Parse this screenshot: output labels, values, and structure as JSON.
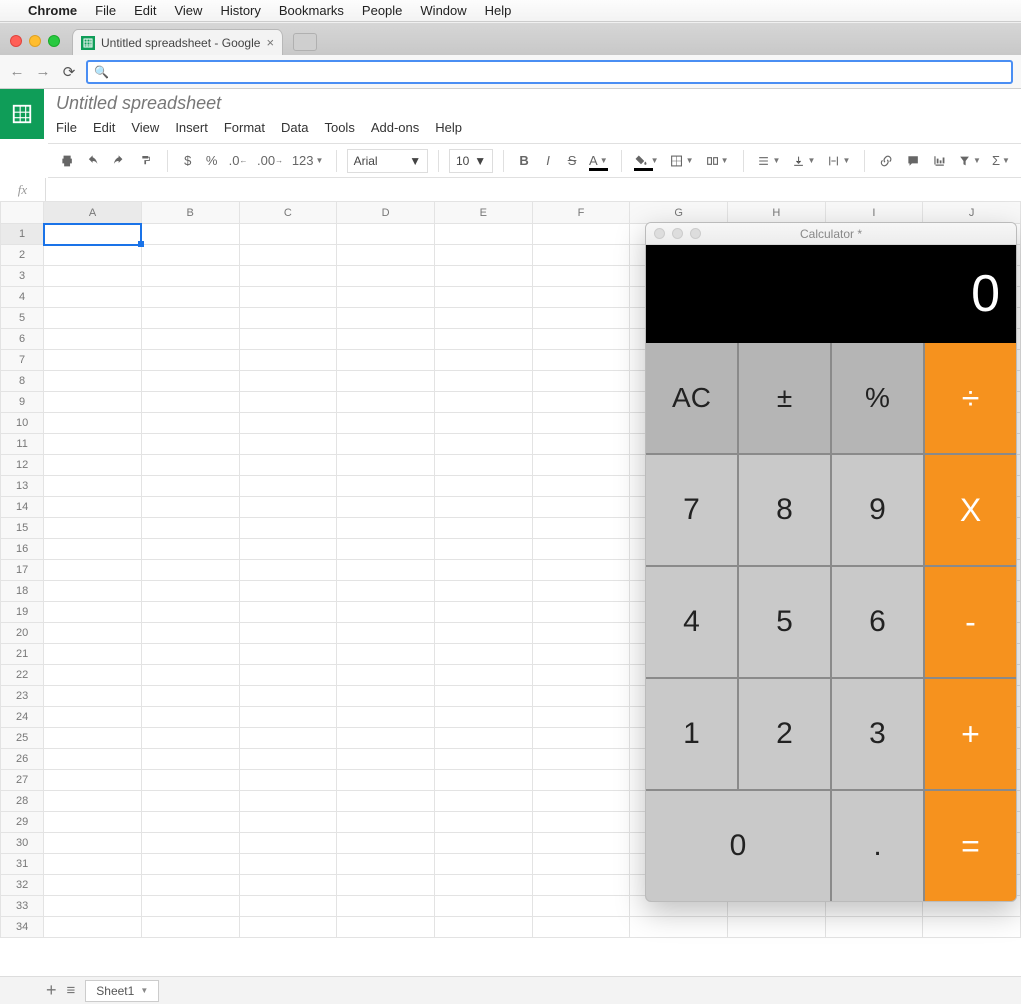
{
  "mac_menubar": {
    "apple": "",
    "app": "Chrome",
    "items": [
      "File",
      "Edit",
      "View",
      "History",
      "Bookmarks",
      "People",
      "Window",
      "Help"
    ]
  },
  "chrome": {
    "tab_title": "Untitled spreadsheet - Google",
    "omnibox_value": ""
  },
  "sheets": {
    "doc_title": "Untitled spreadsheet",
    "menus": [
      "File",
      "Edit",
      "View",
      "Insert",
      "Format",
      "Data",
      "Tools",
      "Add-ons",
      "Help"
    ],
    "toolbar": {
      "currency": "$",
      "percent": "%",
      "dec_dec": ".0",
      "inc_dec": ".00",
      "numfmt": "123",
      "font": "Arial",
      "size": "10",
      "bold": "B",
      "italic": "I",
      "strike": "S",
      "textcolor": "A"
    },
    "fx_label": "fx",
    "columns": [
      "A",
      "B",
      "C",
      "D",
      "E",
      "F",
      "G",
      "H",
      "I",
      "J"
    ],
    "rows": 34,
    "sheet_tab": "Sheet1",
    "add_label": "+",
    "all_sheets": "≡"
  },
  "calculator": {
    "title": "Calculator *",
    "display": "0",
    "keys": {
      "ac": "AC",
      "pm": "±",
      "pct": "%",
      "div": "÷",
      "7": "7",
      "8": "8",
      "9": "9",
      "mul": "X",
      "4": "4",
      "5": "5",
      "6": "6",
      "sub": "-",
      "1": "1",
      "2": "2",
      "3": "3",
      "add": "+",
      "0": "0",
      "dot": ".",
      "eq": "="
    }
  }
}
